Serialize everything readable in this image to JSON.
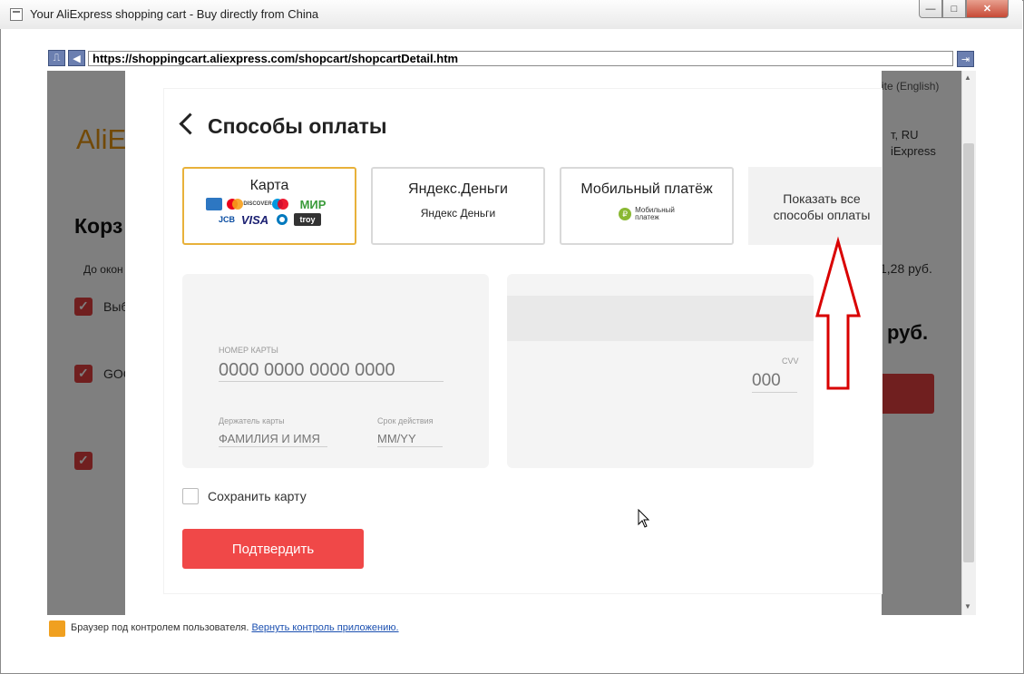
{
  "window": {
    "title": "Your AliExpress shopping cart - Buy directly from China",
    "min": "—",
    "max": "□",
    "close": "✕"
  },
  "address_bar": {
    "url": "https://shoppingcart.aliexpress.com/shopcart/shopcartDetail.htm"
  },
  "background_page": {
    "logo": "AliE",
    "site_link": "l Site (English)",
    "ship_to_line1": "т, RU",
    "ship_to_line2": "iExpress",
    "cart_title": "Корз",
    "until_text": "До окон",
    "select_text": "Выб",
    "item_text": "GOC",
    "price_small": "1,28 руб.",
    "price_total": "руб."
  },
  "modal": {
    "title": "Способы оплаты",
    "methods": [
      {
        "label": "Карта",
        "selected": true
      },
      {
        "label": "Яндекс.Деньги",
        "logo_text": "Яндекс Деньги"
      },
      {
        "label": "Мобильный платёж",
        "logo_text": "Мобильный платеж"
      }
    ],
    "card_logos": [
      "AMEX",
      "MC",
      "DISCOVER",
      "MC",
      "МИР",
      "JCB",
      "VISA",
      "DC",
      "troy"
    ],
    "mp_logo_line1": "Мобильный",
    "mp_logo_line2": "платеж",
    "show_all": "Показать все способы оплаты",
    "card_number_label": "НОМЕР КАРТЫ",
    "card_number_placeholder": "0000 0000 0000 0000",
    "holder_label": "Держатель карты",
    "holder_placeholder": "ФАМИЛИЯ И ИМЯ",
    "expiry_label": "Срок действия",
    "expiry_placeholder": "ММ/YY",
    "cvv_label": "CVV",
    "cvv_placeholder": "000",
    "save_card": "Сохранить карту",
    "confirm": "Подтвердить"
  },
  "status_bar": {
    "text": "Браузер под контролем пользователя.",
    "link": "Вернуть контроль приложению."
  },
  "colors": {
    "accent_red": "#f04848",
    "selected_border": "#e8b13a",
    "annotation_arrow": "#d90000"
  }
}
